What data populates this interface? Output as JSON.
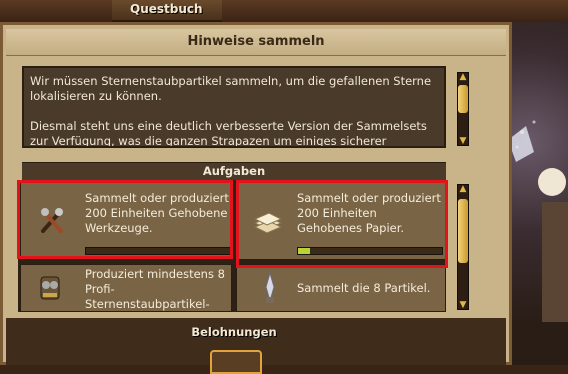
{
  "header": {
    "title": "Questbuch"
  },
  "panel": {
    "subtitle": "Hinweise sammeln"
  },
  "description": {
    "paragraph1": "Wir müssen Sternenstaubpartikel sammeln, um die gefallenen Sterne lokalisieren zu können.",
    "paragraph2": "Diesmal steht uns eine deutlich verbesserte Version der Sammelsets zur Verfügung, was die ganzen Strapazen um einiges sicherer machen."
  },
  "tasks_header": "Aufgaben",
  "tasks": [
    {
      "text": "Sammelt oder produziert 200 Einheiten Gehobene Werkzeuge.",
      "progress": 0.0,
      "icon": "tools-icon"
    },
    {
      "text": "Sammelt oder produziert 200 Einheiten Gehobenes Papier.",
      "progress": 0.08,
      "icon": "paper-icon"
    },
    {
      "text": "Produziert mindestens 8 Profi-Sternenstaubpartikel-",
      "icon": "collector-icon"
    },
    {
      "text": "Sammelt die 8 Partikel.",
      "icon": "crystal-icon"
    }
  ],
  "rewards_header": "Belohnungen",
  "colors": {
    "highlight": "#e3121b",
    "progress_fill": "#b9d23a"
  }
}
